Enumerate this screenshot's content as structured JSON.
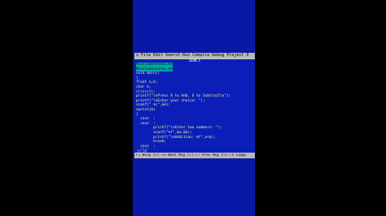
{
  "menu": {
    "sys": "≡",
    "items": [
      "File",
      "Edit",
      "Search",
      "Run",
      "Compile",
      "Debug",
      "Project",
      "O"
    ]
  },
  "editor": {
    "title": "IBAN.C",
    "lines": [
      {
        "text": "#include<stdio.h>",
        "hl": true
      },
      {
        "text": "#include<conio.h>",
        "hl": true
      },
      {
        "text": "void main()",
        "hl": false
      },
      {
        "text": "{",
        "hl": false
      },
      {
        "text": "float a,b;",
        "hl": false
      },
      {
        "text": "char k;",
        "hl": false
      },
      {
        "text": "clrscr();",
        "hl": false
      },
      {
        "text": "printf(\"\\nPress A to Add, S to Subtract\\n\");",
        "hl": false
      },
      {
        "text": "printf(\"\\nEnter your choice: \");",
        "hl": false
      },
      {
        "text": "scanf(\" %c\",&k);",
        "hl": false
      },
      {
        "text": "switch(k)",
        "hl": false
      },
      {
        "text": "{",
        "hl": false
      },
      {
        "text": "  case  :",
        "hl": false
      },
      {
        "text": "  case  :",
        "hl": false
      },
      {
        "text": "        printf(\"\\nEnter two numbers: \");",
        "hl": false
      },
      {
        "text": "        scanf(\"%f\",&a,&b);",
        "hl": false
      },
      {
        "text": "        printf(\"\\nAddition: %f\",a+b);",
        "hl": false
      },
      {
        "text": "        break;",
        "hl": false
      },
      {
        "text": "  case  :",
        "hl": false
      },
      {
        "text": "  case  :",
        "hl": false
      },
      {
        "text": "        printf(\"\\nEnter two numbers: \");",
        "hl": false
      }
    ]
  },
  "status": {
    "position": "25:39"
  },
  "hints": [
    {
      "key": "F1",
      "label": "Help"
    },
    {
      "key": "Alt-F8",
      "label": "Next Msg"
    },
    {
      "key": "Alt-F7",
      "label": "Prev Msg"
    },
    {
      "key": "Alt-F9",
      "label": "Compi"
    }
  ],
  "colors": {
    "background": "#0b1fb8",
    "menu": "#b8b8b8",
    "highlight": "#00a8a8"
  }
}
